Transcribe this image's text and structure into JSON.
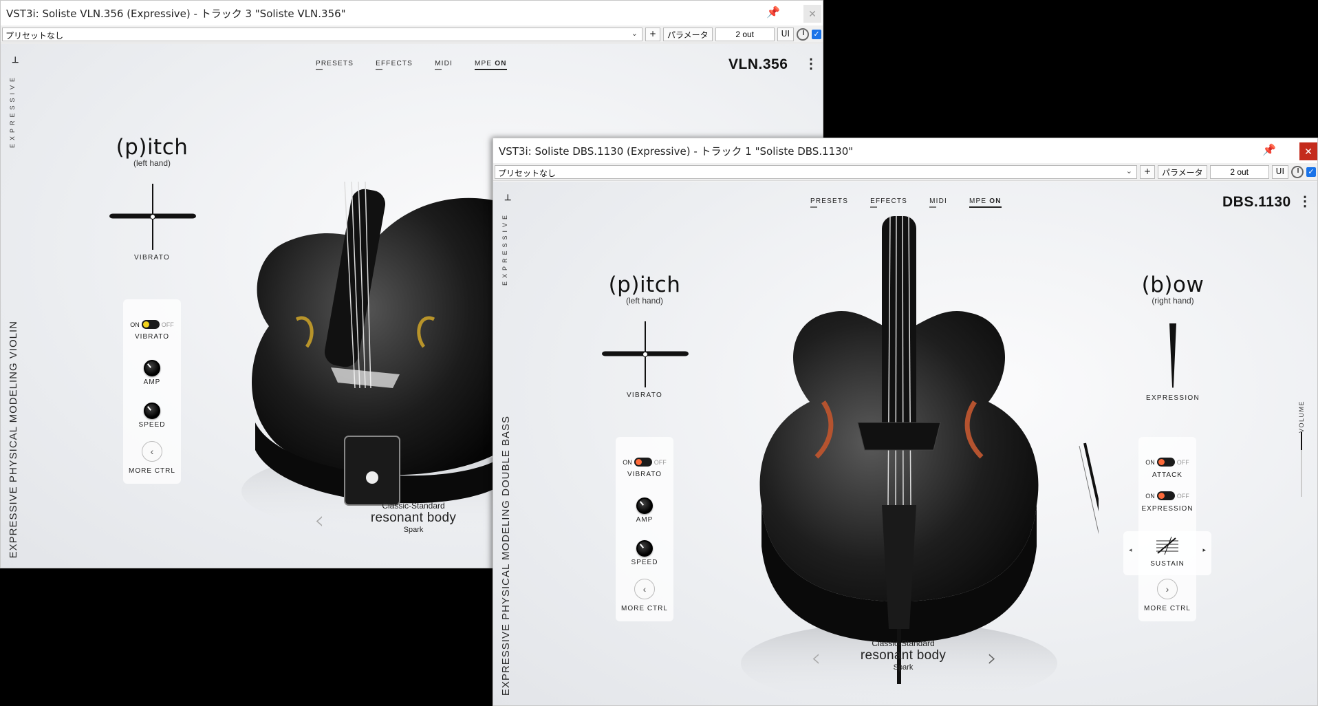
{
  "win1": {
    "title": "VST3i: Soliste VLN.356 (Expressive) - トラック 3 \"Soliste VLN.356\"",
    "preset": "プリセットなし",
    "btn_plus": "+",
    "btn_param": "パラメータ",
    "out": "2 out",
    "btn_ui": "UI",
    "plugin": {
      "logo": "⊥",
      "brand_vertical": "EXPRESSIVE",
      "product_vertical": "EXPRESSIVE PHYSICAL MODELING VIOLIN",
      "nav": [
        "PRESETS",
        "EFFECTS",
        "MIDI"
      ],
      "nav_mpe": "MPE",
      "nav_mpe_state": "ON",
      "instrument": "VLN.356",
      "pitch_title": "(p)itch",
      "pitch_sub": "(left hand)",
      "pitch_caption": "VIBRATO",
      "toggle_on": "ON",
      "toggle_off": "OFF",
      "vibrato_label": "VIBRATO",
      "amp_label": "AMP",
      "speed_label": "SPEED",
      "more_ctrl": "MORE CTRL",
      "preset_category": "Classic-Standard",
      "preset_name": "resonant body",
      "preset_author": "Spark"
    }
  },
  "win2": {
    "title": "VST3i: Soliste DBS.1130 (Expressive) - トラック 1 \"Soliste DBS.1130\"",
    "preset": "プリセットなし",
    "btn_plus": "+",
    "btn_param": "パラメータ",
    "out": "2 out",
    "btn_ui": "UI",
    "plugin": {
      "logo": "⊥",
      "brand_vertical": "EXPRESSIVE",
      "product_vertical": "EXPRESSIVE PHYSICAL MODELING DOUBLE BASS",
      "nav": [
        "PRESETS",
        "EFFECTS",
        "MIDI"
      ],
      "nav_mpe": "MPE",
      "nav_mpe_state": "ON",
      "instrument": "DBS.1130",
      "pitch_title": "(p)itch",
      "pitch_sub": "(left hand)",
      "pitch_caption": "VIBRATO",
      "bow_title": "(b)ow",
      "bow_sub": "(right hand)",
      "bow_caption": "EXPRESSION",
      "toggle_on": "ON",
      "toggle_off": "OFF",
      "vibrato_label": "VIBRATO",
      "amp_label": "AMP",
      "speed_label": "SPEED",
      "more_ctrl": "MORE CTRL",
      "attack_label": "ATTACK",
      "expression_label": "EXPRESSION",
      "sustain_label": "SUSTAIN",
      "volume_label": "VOLUME",
      "preset_category": "Classic-Standard",
      "preset_name": "resonant body",
      "preset_author": "Spark"
    }
  },
  "colors": {
    "toggle_yellow": "#f2d21b",
    "toggle_orange": "#ff6a3a"
  }
}
